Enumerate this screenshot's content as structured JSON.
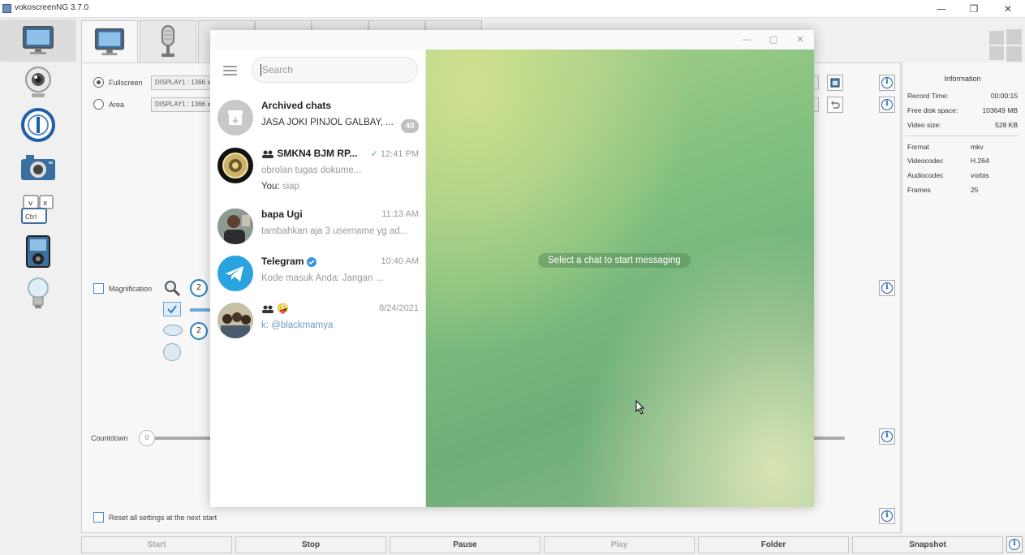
{
  "window": {
    "title": "vokoscreenNG 3.7.0"
  },
  "screen": {
    "fullscreen_label": "Fullscreen",
    "area_label": "Area",
    "fullscreen_display": "DISPLAY1 : 1366 x 768",
    "area_display": "DISPLAY1 : 1366 x 768",
    "magnification_label": "Magnification",
    "magnification_value_1": "2",
    "magnification_value_2": "2",
    "countdown_label": "Countdown",
    "countdown_value": "0",
    "reset_label": "Reset all settings at the next start"
  },
  "information": {
    "title": "Information",
    "record_time_label": "Record Time:",
    "record_time_value": "00:00:15",
    "free_disk_label": "Free disk space:",
    "free_disk_value": "103649  MB",
    "video_size_label": "Video size:",
    "video_size_value": "528  KB",
    "format_label": "Format",
    "format_value": "mkv",
    "videocodec_label": "Videocodec",
    "videocodec_value": "H.264",
    "audiocodec_label": "Audiocodec",
    "audiocodec_value": "vorbis",
    "frames_label": "Frames",
    "frames_value": "25"
  },
  "bottom_buttons": {
    "start": "Start",
    "stop": "Stop",
    "pause": "Pause",
    "play": "Play",
    "folder": "Folder",
    "snapshot": "Snapshot"
  },
  "telegram": {
    "search_placeholder": "Search",
    "empty_state": "Select a chat to start messaging",
    "chats": [
      {
        "name": "Archived chats",
        "preview": "JASA JOKI PINJOL GALBAY, ...",
        "badge": "40"
      },
      {
        "name": "SMKN4 BJM RP...",
        "time": "12:41 PM",
        "preview": "obrolan    tugas    dokume...",
        "you_label": "You:",
        "you_text": "siap"
      },
      {
        "name": "bapa Ugi",
        "time": "11:13 AM",
        "preview": "tambahkan aja 3 username yg ad..."
      },
      {
        "name": "Telegram",
        "time": "10:40 AM",
        "preview": "Kode masuk Anda:       Jangan ..."
      },
      {
        "name": "🤪",
        "time": "8/24/2021",
        "preview": "k: @blackmamya"
      }
    ]
  },
  "colors": {
    "accent": "#2c7fc4",
    "telegram_blue": "#2aa3e0",
    "wallpaper_green": "#7fbf7e"
  }
}
